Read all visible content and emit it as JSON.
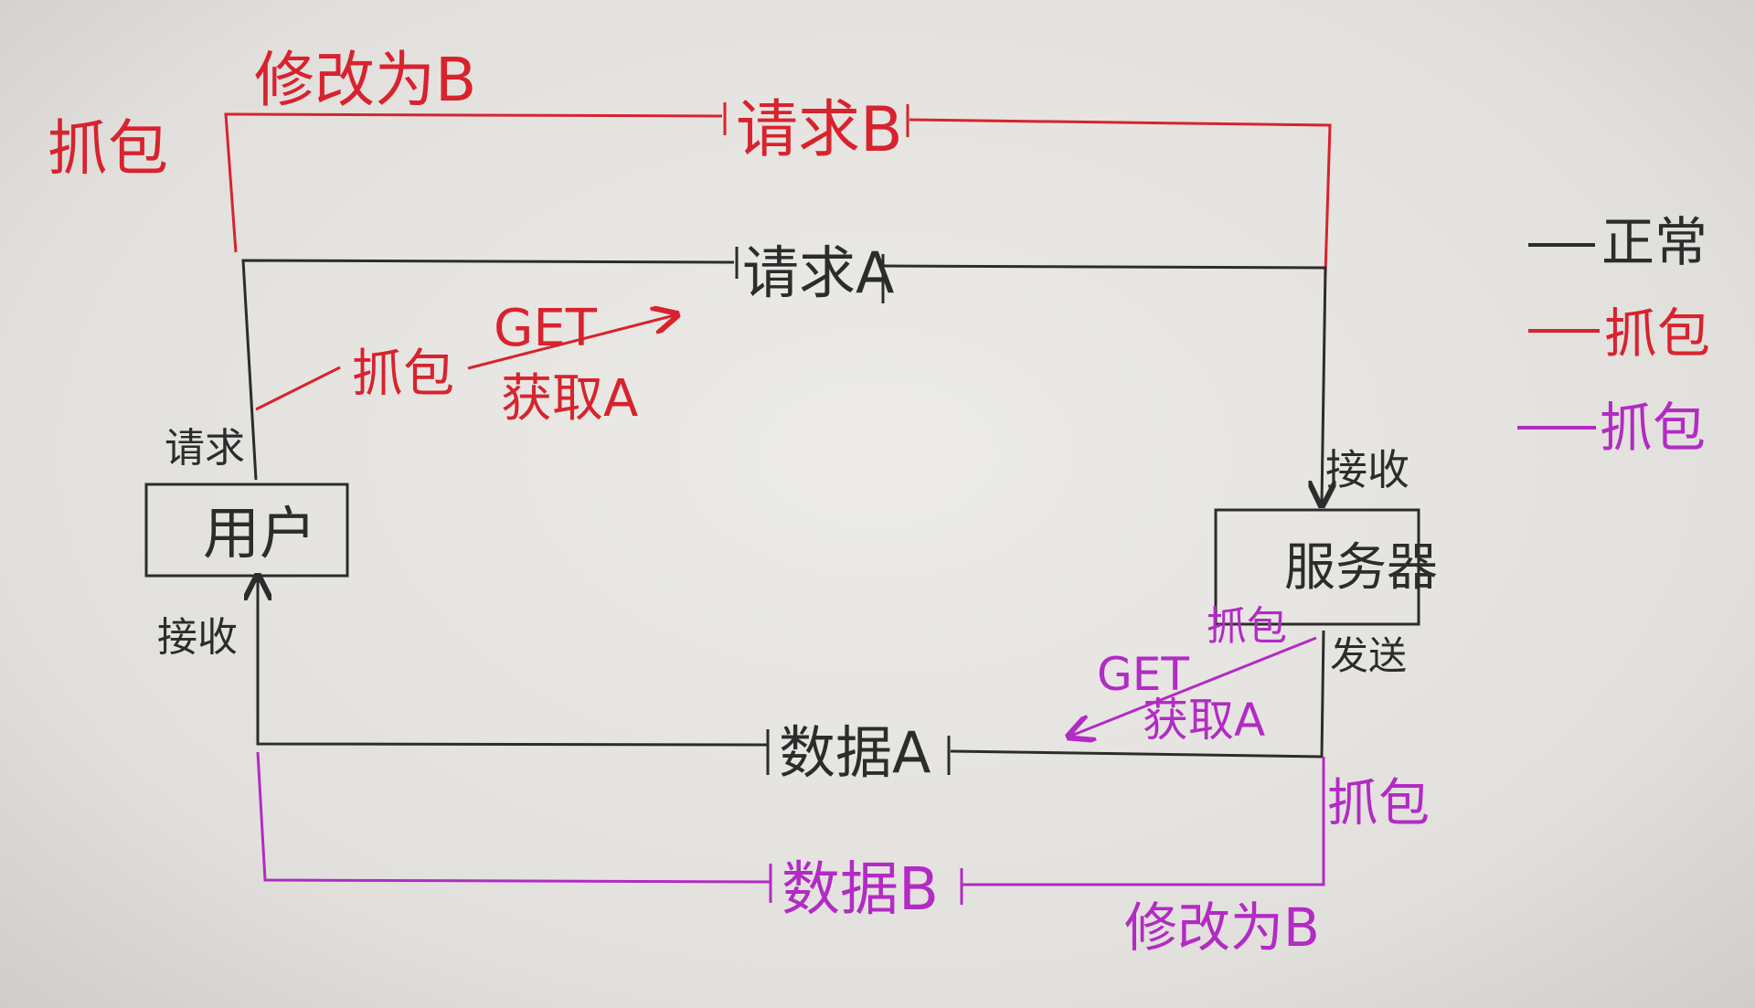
{
  "colors": {
    "black": "#2c2c2c",
    "red": "#d8232e",
    "purple": "#b22bc4"
  },
  "nodes": {
    "user": "用户",
    "server": "服务器"
  },
  "red_path": {
    "capture_label": "抓包",
    "modify_label": "修改为B",
    "line_label": "请求B"
  },
  "black_request": {
    "line_label": "请求A",
    "send_label": "请求",
    "receive_label": "接收"
  },
  "red_annotation": {
    "capture_label": "抓包",
    "method": "GET",
    "action": "获取A"
  },
  "black_response": {
    "line_label": "数据A",
    "send_label": "发送",
    "receive_label": "接收"
  },
  "purple_annotation": {
    "capture_label": "抓包",
    "method": "GET",
    "action": "获取A"
  },
  "purple_path": {
    "capture_label": "抓包",
    "line_label": "数据B",
    "modify_label": "修改为B"
  },
  "legend": {
    "items": [
      {
        "label": "正常",
        "color": "#2c2c2c"
      },
      {
        "label": "抓包",
        "color": "#d8232e"
      },
      {
        "label": "抓包",
        "color": "#b22bc4"
      }
    ]
  }
}
